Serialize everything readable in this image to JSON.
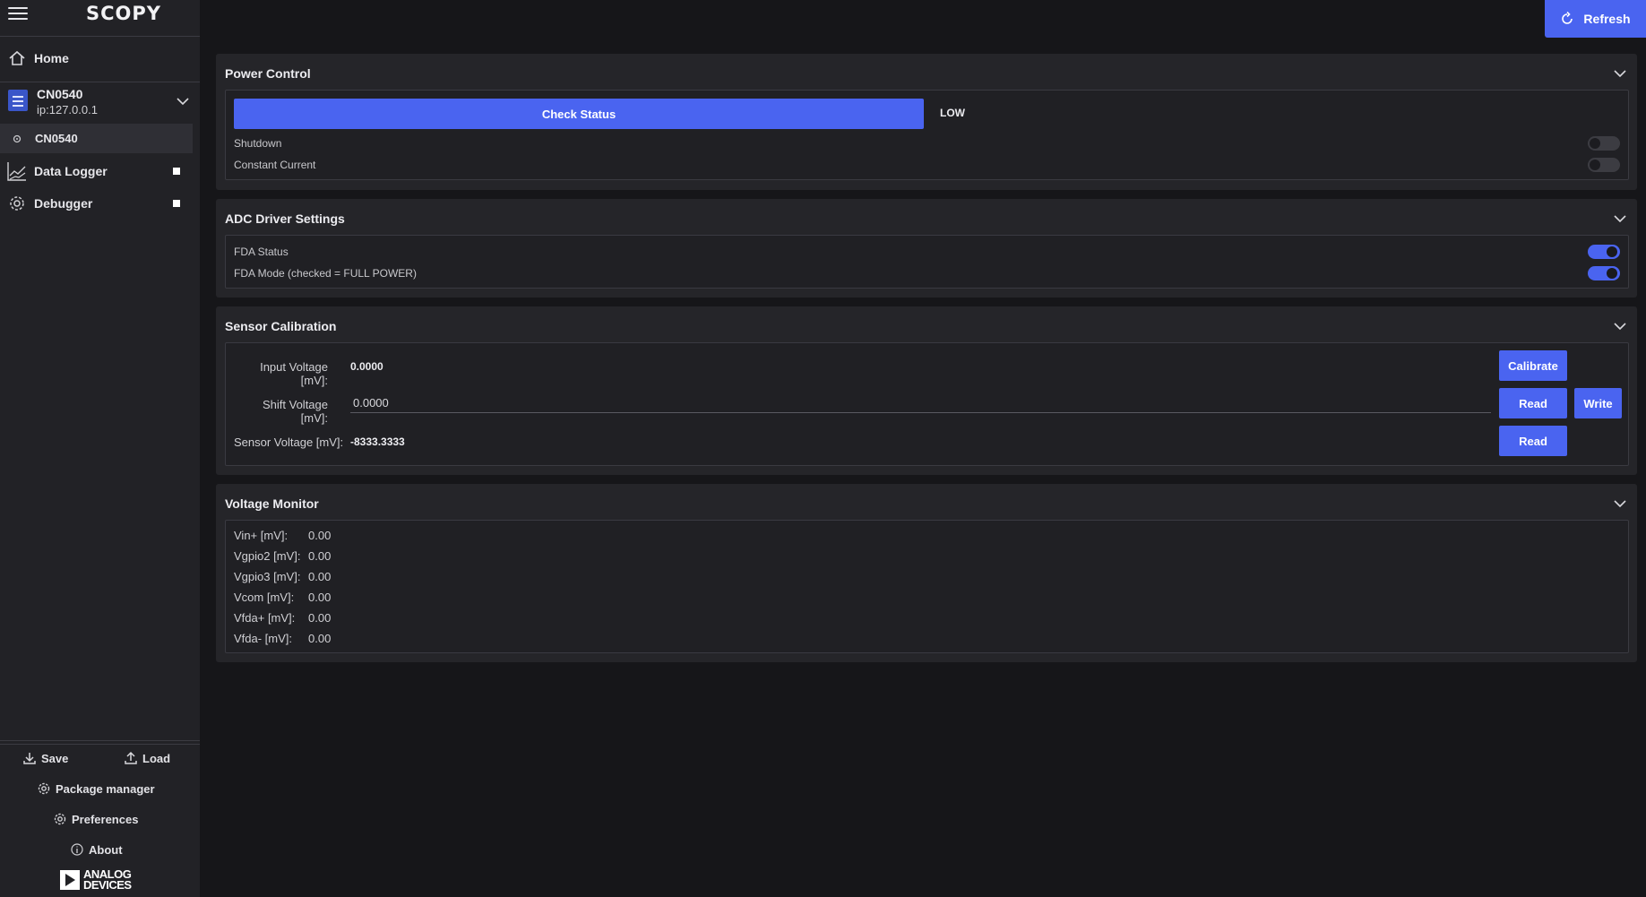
{
  "app": {
    "logo": "SCOPY"
  },
  "sidebar": {
    "home": "Home",
    "device": {
      "name": "CN0540",
      "ip": "ip:127.0.0.1"
    },
    "device_tool": "CN0540",
    "tools": [
      {
        "label": "Data Logger"
      },
      {
        "label": "Debugger"
      }
    ],
    "bottom": {
      "save": "Save",
      "load": "Load",
      "package_manager": "Package manager",
      "preferences": "Preferences",
      "about": "About"
    },
    "brand": {
      "line1": "ANALOG",
      "line2": "DEVICES"
    }
  },
  "toolbar": {
    "refresh": "Refresh"
  },
  "power_control": {
    "title": "Power Control",
    "check_status": "Check Status",
    "status_value": "LOW",
    "shutdown": {
      "label": "Shutdown",
      "on": false
    },
    "constant_current": {
      "label": "Constant Current",
      "on": false
    }
  },
  "adc_driver": {
    "title": "ADC Driver Settings",
    "fda_status": {
      "label": "FDA Status",
      "on": true
    },
    "fda_mode": {
      "label": "FDA Mode (checked = FULL POWER)",
      "on": true
    }
  },
  "sensor_calibration": {
    "title": "Sensor Calibration",
    "input_voltage": {
      "label": "Input Voltage [mV]:",
      "value": "0.0000"
    },
    "shift_voltage": {
      "label": "Shift Voltage [mV]:",
      "value": "0.0000"
    },
    "sensor_voltage": {
      "label": "Sensor Voltage [mV]:",
      "value": "-8333.3333"
    },
    "calibrate": "Calibrate",
    "read": "Read",
    "write": "Write"
  },
  "voltage_monitor": {
    "title": "Voltage Monitor",
    "rows": [
      {
        "label": "Vin+ [mV]:",
        "value": "0.00"
      },
      {
        "label": "Vgpio2 [mV]:",
        "value": "0.00"
      },
      {
        "label": "Vgpio3 [mV]:",
        "value": "0.00"
      },
      {
        "label": "Vcom [mV]:",
        "value": "0.00"
      },
      {
        "label": "Vfda+ [mV]:",
        "value": "0.00"
      },
      {
        "label": "Vfda- [mV]:",
        "value": "0.00"
      }
    ]
  },
  "colors": {
    "accent": "#4a64f0",
    "background": "#161619",
    "panel": "#252529",
    "sidebar": "#222226"
  }
}
